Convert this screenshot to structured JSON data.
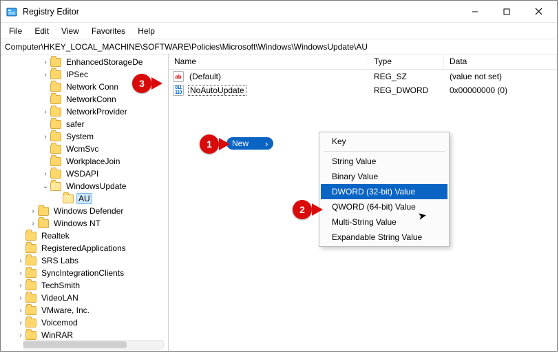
{
  "title": "Registry Editor",
  "menubar": [
    "File",
    "Edit",
    "View",
    "Favorites",
    "Help"
  ],
  "path": "Computer\\HKEY_LOCAL_MACHINE\\SOFTWARE\\Policies\\Microsoft\\Windows\\WindowsUpdate\\AU",
  "tree": {
    "items": [
      {
        "indent": 3,
        "tw": ">",
        "label": "EnhancedStorageDevices",
        "trunc": "EnhancedStorageDe"
      },
      {
        "indent": 3,
        "tw": ">",
        "label": "IPSec"
      },
      {
        "indent": 3,
        "tw": "",
        "label": "Network Connections",
        "trunc": "Network Conn"
      },
      {
        "indent": 3,
        "tw": "",
        "label": "NetworkConnectivity",
        "trunc": "NetworkConn"
      },
      {
        "indent": 3,
        "tw": ">",
        "label": "NetworkProvider"
      },
      {
        "indent": 3,
        "tw": "",
        "label": "safer"
      },
      {
        "indent": 3,
        "tw": ">",
        "label": "System"
      },
      {
        "indent": 3,
        "tw": "",
        "label": "WcmSvc"
      },
      {
        "indent": 3,
        "tw": "",
        "label": "WorkplaceJoin"
      },
      {
        "indent": 3,
        "tw": ">",
        "label": "WSDAPI"
      },
      {
        "indent": 3,
        "tw": "v",
        "label": "WindowsUpdate",
        "open": true
      },
      {
        "indent": 4,
        "tw": "",
        "label": "AU",
        "selected": true,
        "open": true
      },
      {
        "indent": 2,
        "tw": ">",
        "label": "Windows Defender"
      },
      {
        "indent": 2,
        "tw": ">",
        "label": "Windows NT"
      },
      {
        "indent": 1,
        "tw": "",
        "label": "Realtek"
      },
      {
        "indent": 1,
        "tw": "",
        "label": "RegisteredApplications"
      },
      {
        "indent": 1,
        "tw": ">",
        "label": "SRS Labs"
      },
      {
        "indent": 1,
        "tw": ">",
        "label": "SyncIntegrationClients"
      },
      {
        "indent": 1,
        "tw": ">",
        "label": "TechSmith"
      },
      {
        "indent": 1,
        "tw": ">",
        "label": "VideoLAN"
      },
      {
        "indent": 1,
        "tw": ">",
        "label": "VMware, Inc."
      },
      {
        "indent": 1,
        "tw": ">",
        "label": "Voicemod"
      },
      {
        "indent": 1,
        "tw": ">",
        "label": "WinRAR"
      }
    ]
  },
  "columns": {
    "name": "Name",
    "type": "Type",
    "data": "Data"
  },
  "values": [
    {
      "kind": "sz",
      "name": "(Default)",
      "type": "REG_SZ",
      "data": "(value not set)"
    },
    {
      "kind": "dw",
      "name": "NoAutoUpdate",
      "type": "REG_DWORD",
      "data": "0x00000000 (0)",
      "renaming": true
    }
  ],
  "context_parent": {
    "new": "New"
  },
  "context_sub": {
    "items": [
      {
        "label": "Key"
      },
      {
        "sep": true
      },
      {
        "label": "String Value"
      },
      {
        "label": "Binary Value"
      },
      {
        "label": "DWORD (32-bit) Value",
        "hi": true
      },
      {
        "label": "QWORD (64-bit) Value"
      },
      {
        "label": "Multi-String Value"
      },
      {
        "label": "Expandable String Value"
      }
    ]
  },
  "callouts": {
    "c1": "1",
    "c2": "2",
    "c3": "3"
  }
}
